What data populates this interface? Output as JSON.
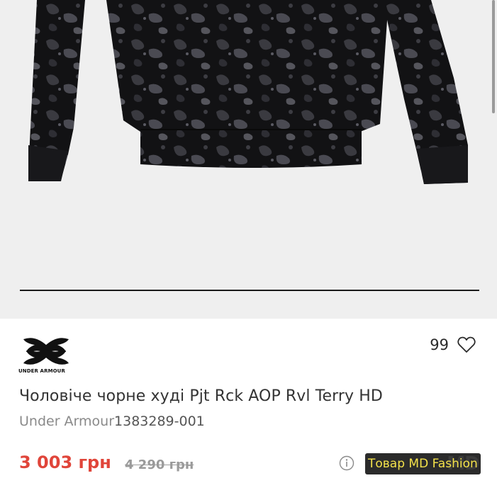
{
  "product": {
    "title": "Чоловіче чорне худі Pjt Rck AOP Rvl Terry HD",
    "brand_name": "Under Armour",
    "sku": "1383289-001",
    "brand_logo_text": "UNDER ARMOUR",
    "likes": "99",
    "price_current": "3 003 грн",
    "price_old": "4 290 грн",
    "seller_badge": "Товар MD Fashion"
  },
  "icons": {
    "heart": "heart-icon",
    "info": "info-icon",
    "logo": "under-armour-logo"
  },
  "colors": {
    "price_accent": "#e0453a",
    "badge_bg": "#2b2b2b",
    "badge_text": "#f4e24a",
    "image_bg": "#efefef"
  }
}
